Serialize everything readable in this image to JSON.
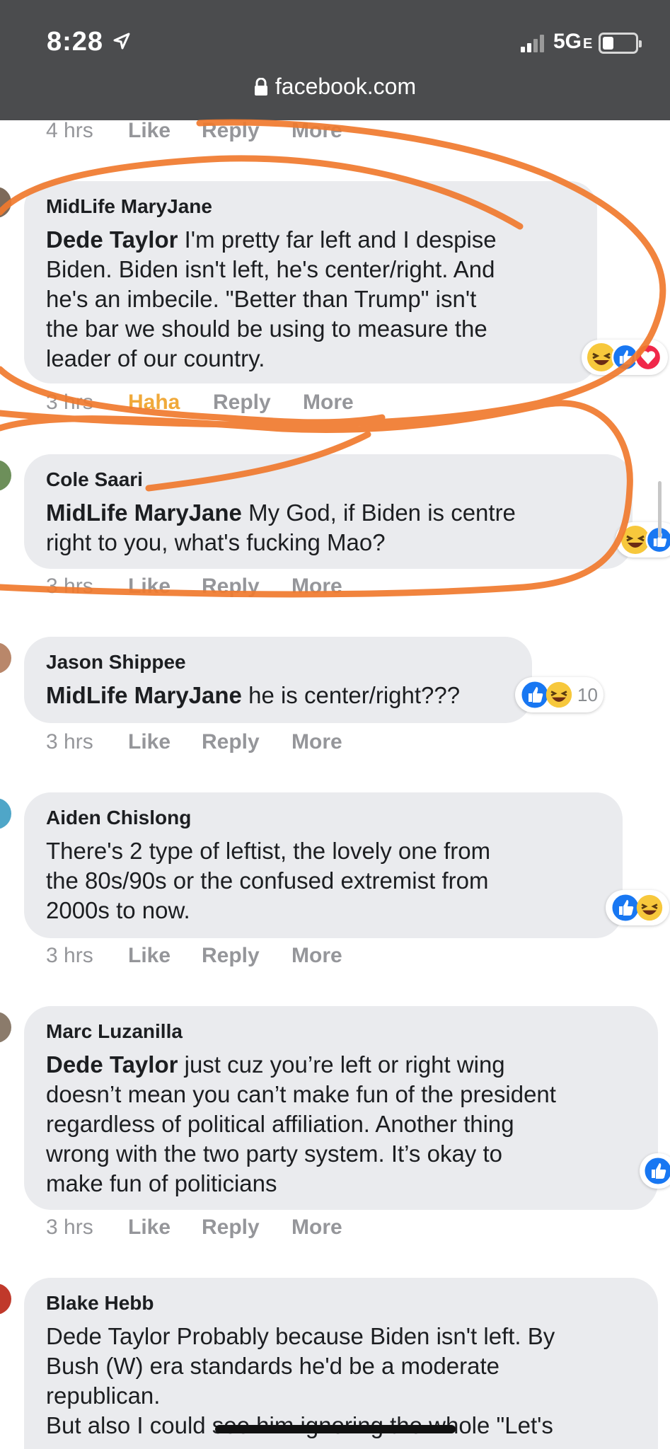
{
  "status_bar": {
    "time": "8:28",
    "network": "5G",
    "network_suffix": "E",
    "url": "facebook.com"
  },
  "comments": [
    {
      "author": "",
      "time": "4 hrs",
      "like": "Like",
      "reply": "Reply",
      "more": "More"
    },
    {
      "author": "MidLife MaryJane",
      "mention": "Dede Taylor",
      "text": " I'm pretty far left and I despise\nBiden. Biden isn't left, he's center/right. And\nhe's an imbecile. \"Better than Trump\" isn't\nthe bar we should be using to measure the\nleader of our country.",
      "time": "3 hrs",
      "like": "Haha",
      "reply": "Reply",
      "more": "More",
      "reactions": [
        "haha-icon",
        "like-icon",
        "love-icon"
      ]
    },
    {
      "author": "Cole Saari",
      "mention": "MidLife MaryJane",
      "text": " My God, if Biden is centre\nright to you, what's fucking Mao?",
      "time": "3 hrs",
      "like": "Like",
      "reply": "Reply",
      "more": "More",
      "reactions": [
        "haha-icon",
        "like-icon"
      ]
    },
    {
      "author": "Jason Shippee",
      "mention": "MidLife MaryJane",
      "text": " he is center/right???",
      "time": "3 hrs",
      "like": "Like",
      "reply": "Reply",
      "more": "More",
      "reactions": [
        "like-icon",
        "haha-icon"
      ],
      "reaction_count": "10"
    },
    {
      "author": "Aiden Chislong",
      "mention": "",
      "text": "There's 2 type of leftist, the lovely one from\nthe 80s/90s or the confused extremist from\n2000s to now.",
      "time": "3 hrs",
      "like": "Like",
      "reply": "Reply",
      "more": "More",
      "reactions": [
        "like-icon",
        "haha-icon"
      ]
    },
    {
      "author": "Marc Luzanilla",
      "mention": "Dede Taylor",
      "text": " just cuz you’re left or right wing\ndoesn’t mean you can’t make fun of the president\nregardless of political affiliation. Another thing\nwrong with the two party system. It’s okay to\nmake fun of politicians",
      "time": "3 hrs",
      "like": "Like",
      "reply": "Reply",
      "more": "More",
      "reactions": [
        "like-icon"
      ]
    },
    {
      "author": "Blake Hebb",
      "mention": "",
      "text": "Dede Taylor Probably because Biden isn't left. By\nBush (W) era standards he'd be a moderate\nrepublican.\nBut also I could see him ignoring the whole \"Let's",
      "time": "",
      "like": "",
      "reply": "",
      "more": ""
    }
  ],
  "colors": {
    "status_bar": "#4b4c4e",
    "bubble": "#eaebee",
    "meta_text": "#95969a",
    "haha": "#f0a93a",
    "like_blue": "#1877f2",
    "annotation": "#f07a2e"
  }
}
